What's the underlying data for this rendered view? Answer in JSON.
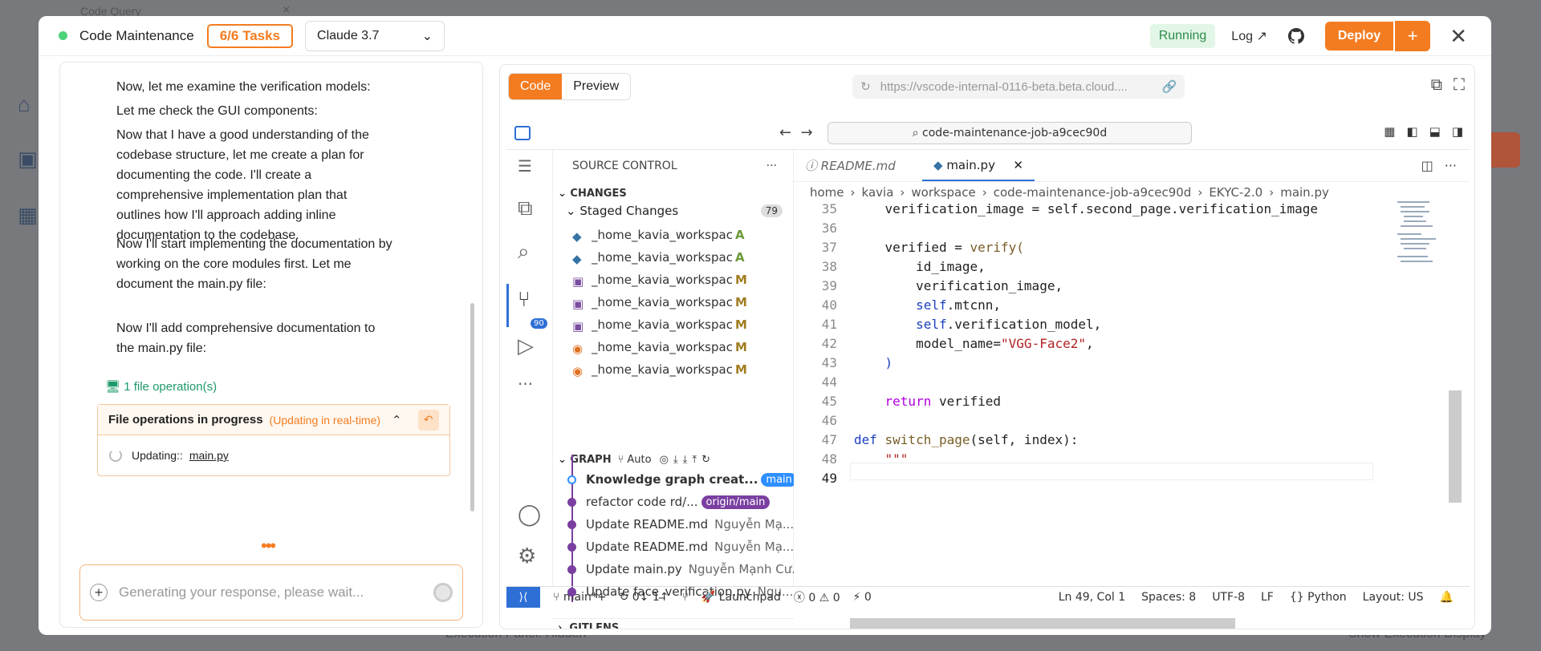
{
  "background": {
    "tab": "Code Query",
    "footer_left": "Execution Panel: Hidden",
    "footer_right": "Show Execution Display"
  },
  "header": {
    "title": "Code Maintenance",
    "tasks": "6/6 Tasks",
    "model": "Claude 3.7",
    "status": "Running",
    "log": "Log",
    "deploy": "Deploy"
  },
  "chat": {
    "messages": [
      "Now, let me examine the verification models:",
      "Let me check the GUI components:",
      "Now that I have a good understanding of the codebase structure, let me create a plan for documenting the code. I'll create a comprehensive implementation plan that outlines how I'll approach adding inline documentation to the codebase.",
      "Now I'll start implementing the documentation by working on the core modules first. Let me document the main.py file:",
      "Now I'll add comprehensive documentation to the main.py file:"
    ],
    "file_ops": "1 file operation(s)",
    "progress_title": "File operations in progress",
    "progress_rt": "(Updating in real-time)",
    "updating_label": "Updating::",
    "updating_file": "main.py",
    "placeholder": "Generating your response, please wait..."
  },
  "preview": {
    "tab_code": "Code",
    "tab_preview": "Preview",
    "url": "https://vscode-internal-0116-beta.beta.cloud...."
  },
  "vscode": {
    "command": "code-maintenance-job-a9cec90d",
    "source_control": "SOURCE CONTROL",
    "changes": "CHANGES",
    "staged": "Staged Changes",
    "staged_count": "79",
    "badge": "90",
    "files": [
      {
        "name": "_home_kavia_workspace_co...",
        "status": "A",
        "kind": "py"
      },
      {
        "name": "_home_kavia_workspace_co...",
        "status": "A",
        "kind": "py"
      },
      {
        "name": "_home_kavia_workspace_co...",
        "status": "M",
        "kind": "img"
      },
      {
        "name": "_home_kavia_workspace_co...",
        "status": "M",
        "kind": "img"
      },
      {
        "name": "_home_kavia_workspace_co...",
        "status": "M",
        "kind": "img"
      },
      {
        "name": "_home_kavia_workspace_co...",
        "status": "M",
        "kind": "rss"
      },
      {
        "name": "_home_kavia_workspace_co...",
        "status": "M",
        "kind": "rss"
      }
    ],
    "graph": "GRAPH",
    "auto": "Auto",
    "commits": [
      {
        "msg": "Knowledge graph creat...",
        "author": "",
        "tag": "main"
      },
      {
        "msg": "refactor code rd/...",
        "author": "",
        "tag": "origin/main"
      },
      {
        "msg": "Update README.md",
        "author": "Nguyễn Mạ...",
        "tag": ""
      },
      {
        "msg": "Update README.md",
        "author": "Nguyễn Mạ...",
        "tag": ""
      },
      {
        "msg": "Update main.py",
        "author": "Nguyễn Mạnh Cư...",
        "tag": ""
      },
      {
        "msg": "Update face_verification.py",
        "author": "Ngu...",
        "tag": ""
      }
    ],
    "gitlens": "GITLENS",
    "tabs": [
      {
        "label": "README.md"
      },
      {
        "label": "main.py"
      }
    ],
    "breadcrumb": [
      "home",
      "kavia",
      "workspace",
      "code-maintenance-job-a9cec90d",
      "EKYC-2.0",
      "main.py"
    ],
    "line_numbers": [
      "35",
      "36",
      "37",
      "38",
      "39",
      "40",
      "41",
      "42",
      "43",
      "44",
      "45",
      "46",
      "47",
      "48",
      "49"
    ],
    "code": {
      "l35": "verification_image = self.second_page.verification_image",
      "l37a": "verified = ",
      "l37b": "verify(",
      "l38": "id_image,",
      "l39": "verification_image,",
      "l40a": "self",
      ".l40b": ".mtcnn,",
      "l41a": "self",
      "l41b": ".verification_model,",
      "l42a": "model_name=",
      "l42b": "\"VGG-Face2\"",
      "l42c": ",",
      "l43": ")",
      "l45a": "return",
      "l45b": " verified",
      "l47a": "def ",
      "l47b": "switch_page",
      "l47c": "(self, index):",
      "l48": "\"\"\""
    },
    "status": {
      "branch": "main*+",
      "sync": "0↓ 1↑",
      "launchpad": "Launchpad",
      "errors": "0",
      "warnings": "0",
      "ports": "0",
      "pos": "Ln 49, Col 1",
      "spaces": "Spaces: 8",
      "enc": "UTF-8",
      "eol": "LF",
      "lang": "Python",
      "layout": "Layout: US"
    }
  },
  "icons": [
    "search-icon",
    "source-control-icon",
    "debug-icon",
    "account-icon",
    "gear-icon",
    "close-icon",
    "github-icon",
    "external-link-icon",
    "fullscreen-icon",
    "reload-icon",
    "link-icon"
  ]
}
